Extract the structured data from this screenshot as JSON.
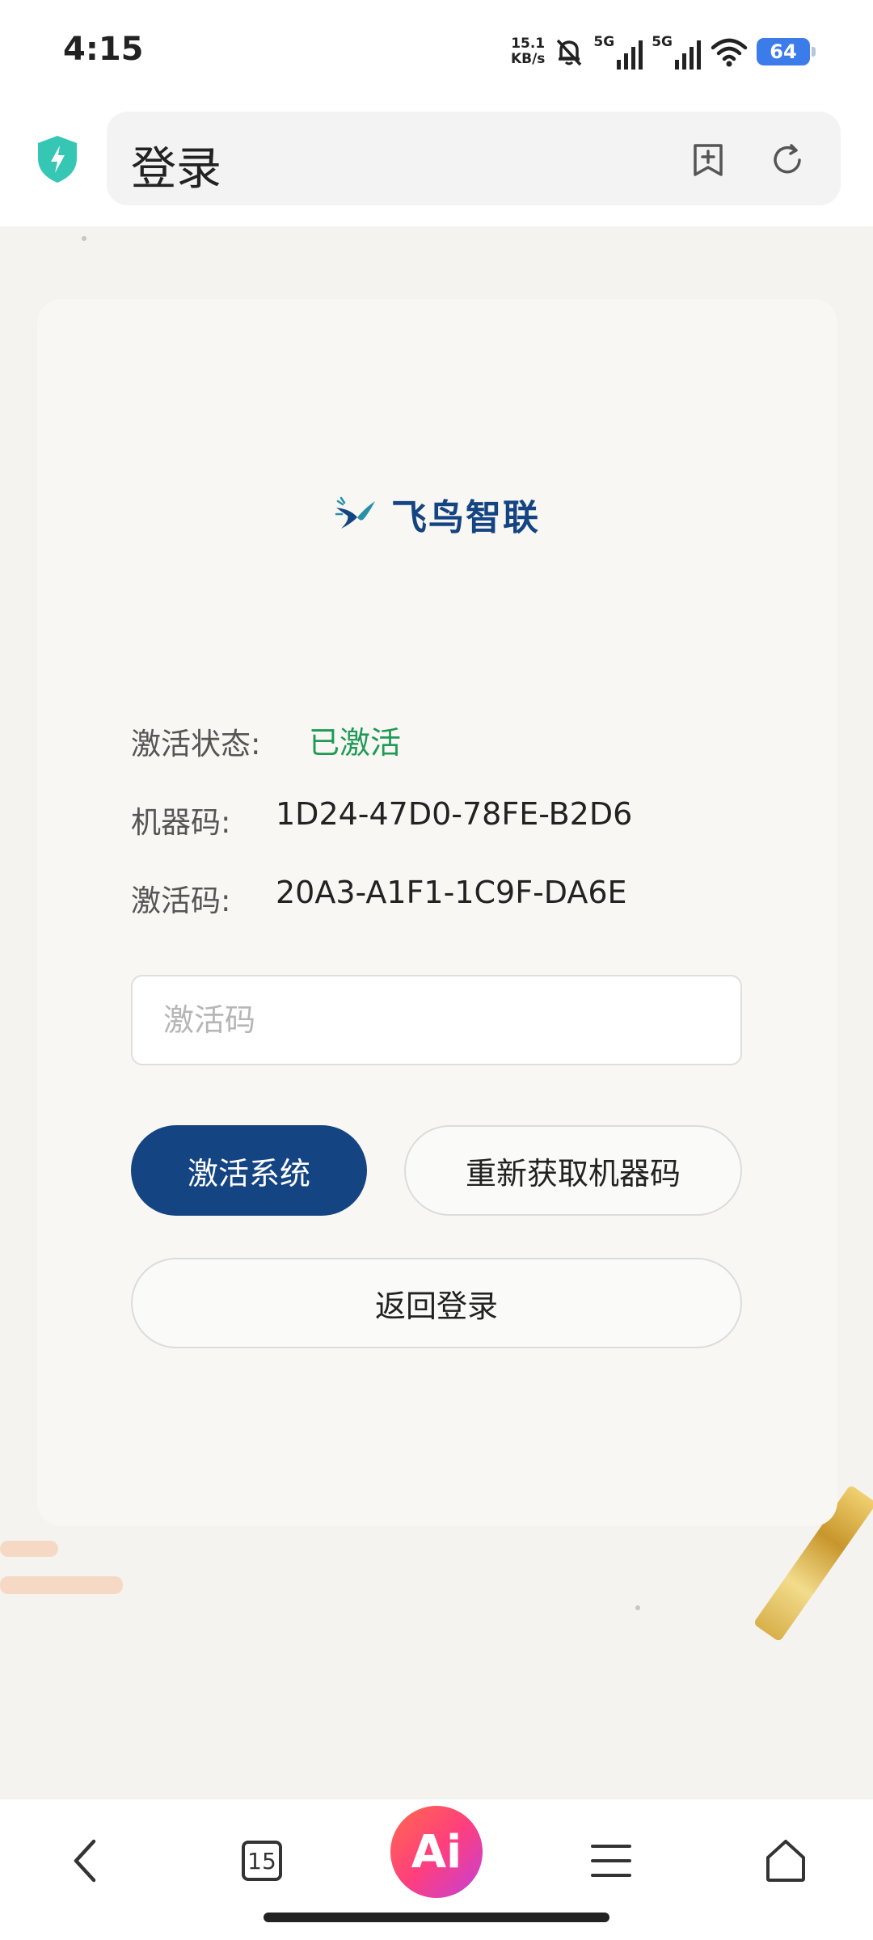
{
  "status_bar": {
    "time": "4:15",
    "net_speed_value": "15.1",
    "net_speed_unit": "KB/s",
    "signal1_label": "5G",
    "signal2_label": "5G",
    "battery": "64"
  },
  "browser": {
    "page_title": "登录"
  },
  "brand": {
    "name": "飞鸟智联"
  },
  "activation": {
    "status_label": "激活状态:",
    "status_value": "已激活",
    "machine_code_label": "机器码:",
    "machine_code_value": "1D24-47D0-78FE-B2D6",
    "activation_code_label": "激活码:",
    "activation_code_value": "20A3-A1F1-1C9F-DA6E",
    "input_placeholder": "激活码",
    "input_value": ""
  },
  "buttons": {
    "activate": "激活系统",
    "refetch_machine_code": "重新获取机器码",
    "back_to_login": "返回登录"
  },
  "bottom_nav": {
    "tab_count": "15",
    "ai_label": "Ai"
  },
  "colors": {
    "brand_blue": "#154483",
    "active_green": "#1f9a55",
    "shield_teal": "#35c7b4",
    "battery_blue": "#3b7bea"
  }
}
